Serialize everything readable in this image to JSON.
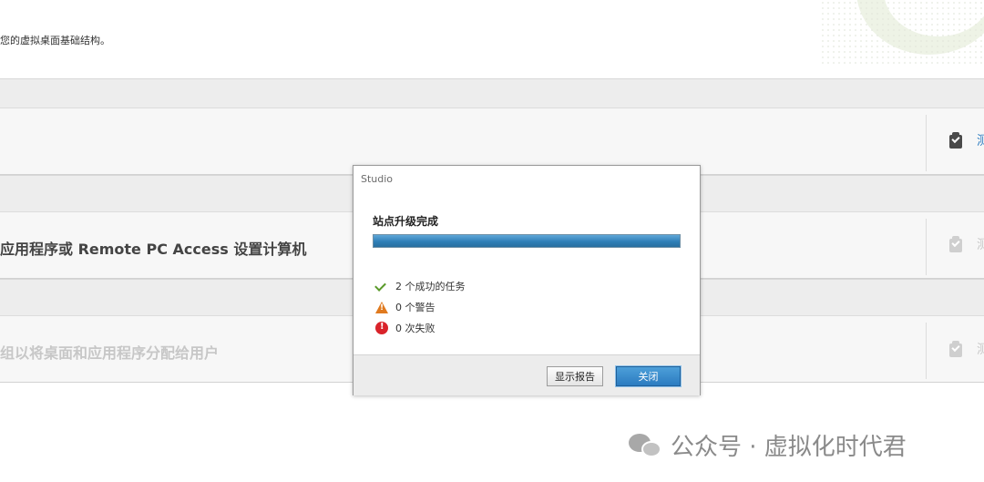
{
  "intro_text": "您的虚拟桌面基础结构。",
  "steps": [
    {
      "title": "",
      "side_link": "测",
      "enabled": true
    },
    {
      "title": "应用程序或 Remote PC Access 设置计算机",
      "side_link": "测",
      "enabled": false
    },
    {
      "title": "组以将桌面和应用程序分配给用户",
      "side_link": "测",
      "enabled": false
    }
  ],
  "dialog": {
    "title": "Studio",
    "heading": "站点升级完成",
    "progress": 1.0,
    "results": [
      {
        "icon": "check-icon",
        "text": "2 个成功的任务"
      },
      {
        "icon": "warning-icon",
        "text": "0 个警告"
      },
      {
        "icon": "error-icon",
        "text": "0 次失败"
      }
    ],
    "buttons": {
      "report": "显示报告",
      "close": "关闭"
    }
  },
  "watermark": "公众号 · 虚拟化时代君",
  "colors": {
    "accent": "#2b7bc0",
    "success": "#5a9a2a",
    "warning": "#e07a1f",
    "error": "#d9232a"
  }
}
